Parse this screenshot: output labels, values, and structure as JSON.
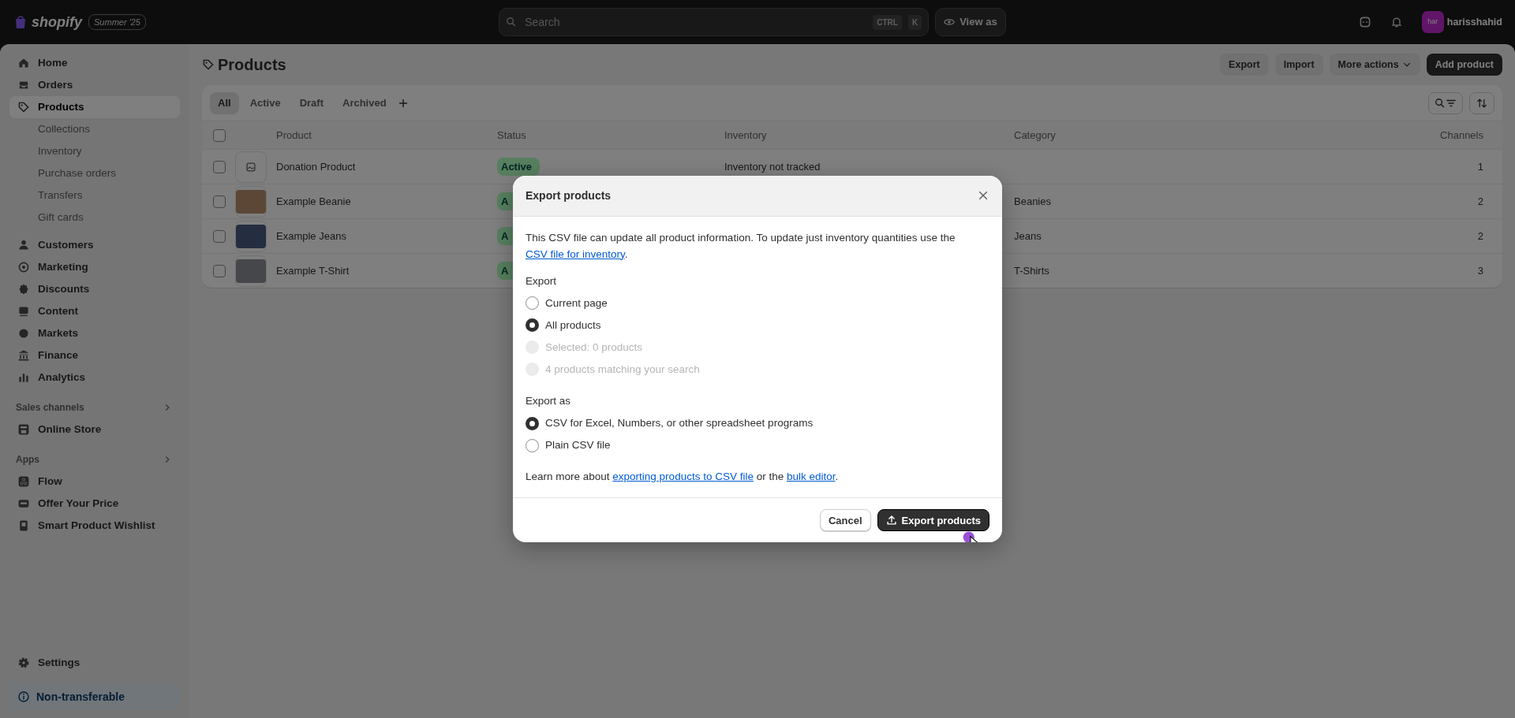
{
  "top_bar": {
    "logo_text": "shopify",
    "edition_badge": "Summer '25",
    "search": {
      "placeholder": "Search"
    },
    "shortcut_keys": [
      "CTRL",
      "K"
    ],
    "view_as_button": "View as",
    "avatar_initials": "har",
    "store_name": "harisshahid"
  },
  "sidebar": {
    "items": [
      {
        "label": "Home",
        "selected": false
      },
      {
        "label": "Orders",
        "selected": false
      },
      {
        "label": "Products",
        "selected": true,
        "children": [
          {
            "label": "Collections",
            "selected": false
          },
          {
            "label": "Inventory",
            "selected": false
          },
          {
            "label": "Purchase orders",
            "selected": false
          },
          {
            "label": "Transfers",
            "selected": false
          },
          {
            "label": "Gift cards",
            "selected": false
          }
        ]
      },
      {
        "label": "Customers",
        "selected": false
      },
      {
        "label": "Marketing",
        "selected": false
      },
      {
        "label": "Discounts",
        "selected": false
      },
      {
        "label": "Content",
        "selected": false
      },
      {
        "label": "Markets",
        "selected": false
      },
      {
        "label": "Finance",
        "selected": false
      },
      {
        "label": "Analytics",
        "selected": false
      }
    ],
    "sections": [
      {
        "title": "Sales channels",
        "items": [
          {
            "label": "Online Store",
            "selected": false
          }
        ]
      },
      {
        "title": "Apps",
        "items": [
          {
            "label": "Flow",
            "selected": false
          },
          {
            "label": "Offer Your Price",
            "selected": false
          },
          {
            "label": "Smart Product Wishlist",
            "selected": false
          }
        ]
      }
    ],
    "settings": "Settings",
    "footer_badge": "Non-transferable"
  },
  "page": {
    "title": "Products",
    "actions": [
      {
        "label": "Export",
        "kind": "secondary"
      },
      {
        "label": "Import",
        "kind": "secondary"
      },
      {
        "label": "More actions",
        "kind": "menu"
      },
      {
        "label": "Add product",
        "kind": "primary"
      }
    ]
  },
  "tabs": [
    {
      "label": "All",
      "selected": true
    },
    {
      "label": "Active",
      "selected": false
    },
    {
      "label": "Draft",
      "selected": false
    },
    {
      "label": "Archived",
      "selected": false
    }
  ],
  "table": {
    "select_all": {
      "checked": false
    },
    "columns": [
      "Product",
      "Status",
      "Inventory",
      "Category",
      "Channels"
    ],
    "rows": [
      {
        "checked": false,
        "kind": "icon",
        "product": "Donation Product",
        "status": "Active",
        "inventory": "Inventory not tracked",
        "channels": "1"
      },
      {
        "checked": false,
        "kind": "photo",
        "product": "Example Beanie",
        "status": "A",
        "category": "Beanies",
        "channels": "2"
      },
      {
        "checked": false,
        "kind": "photo",
        "product": "Example Jeans",
        "status": "A",
        "category": "Jeans",
        "channels": "2"
      },
      {
        "checked": false,
        "kind": "photo",
        "product": "Example T-Shirt",
        "status": "A",
        "category": "T-Shirts",
        "channels": "3"
      }
    ]
  },
  "modal": {
    "title": "Export products",
    "intro": [
      {
        "kind": "text",
        "text": "This CSV file can update all product information. To update just inventory quantities use the "
      },
      {
        "kind": "link",
        "text": "CSV file for inventory"
      },
      {
        "kind": "text",
        "text": "."
      }
    ],
    "groups": [
      {
        "title": "Export",
        "options": [
          {
            "label": "Current page",
            "selected": false,
            "disabled": false
          },
          {
            "label": "All products",
            "selected": true,
            "disabled": false
          },
          {
            "label": "Selected: 0 products",
            "selected": false,
            "disabled": true
          },
          {
            "label": "4 products matching your search",
            "selected": false,
            "disabled": true
          }
        ]
      },
      {
        "title": "Export as",
        "options": [
          {
            "label": "CSV for Excel, Numbers, or other spreadsheet programs",
            "selected": true,
            "disabled": false
          },
          {
            "label": "Plain CSV file",
            "selected": false,
            "disabled": false
          }
        ]
      }
    ],
    "learn_more": [
      {
        "kind": "text",
        "text": "Learn more about "
      },
      {
        "kind": "link",
        "text": "exporting products to CSV file"
      },
      {
        "kind": "text",
        "text": " or the "
      },
      {
        "kind": "link",
        "text": "bulk editor"
      },
      {
        "kind": "text",
        "text": "."
      }
    ],
    "buttons": [
      {
        "label": "Cancel",
        "kind": "secondary"
      },
      {
        "label": "Export products",
        "kind": "primary"
      }
    ]
  }
}
